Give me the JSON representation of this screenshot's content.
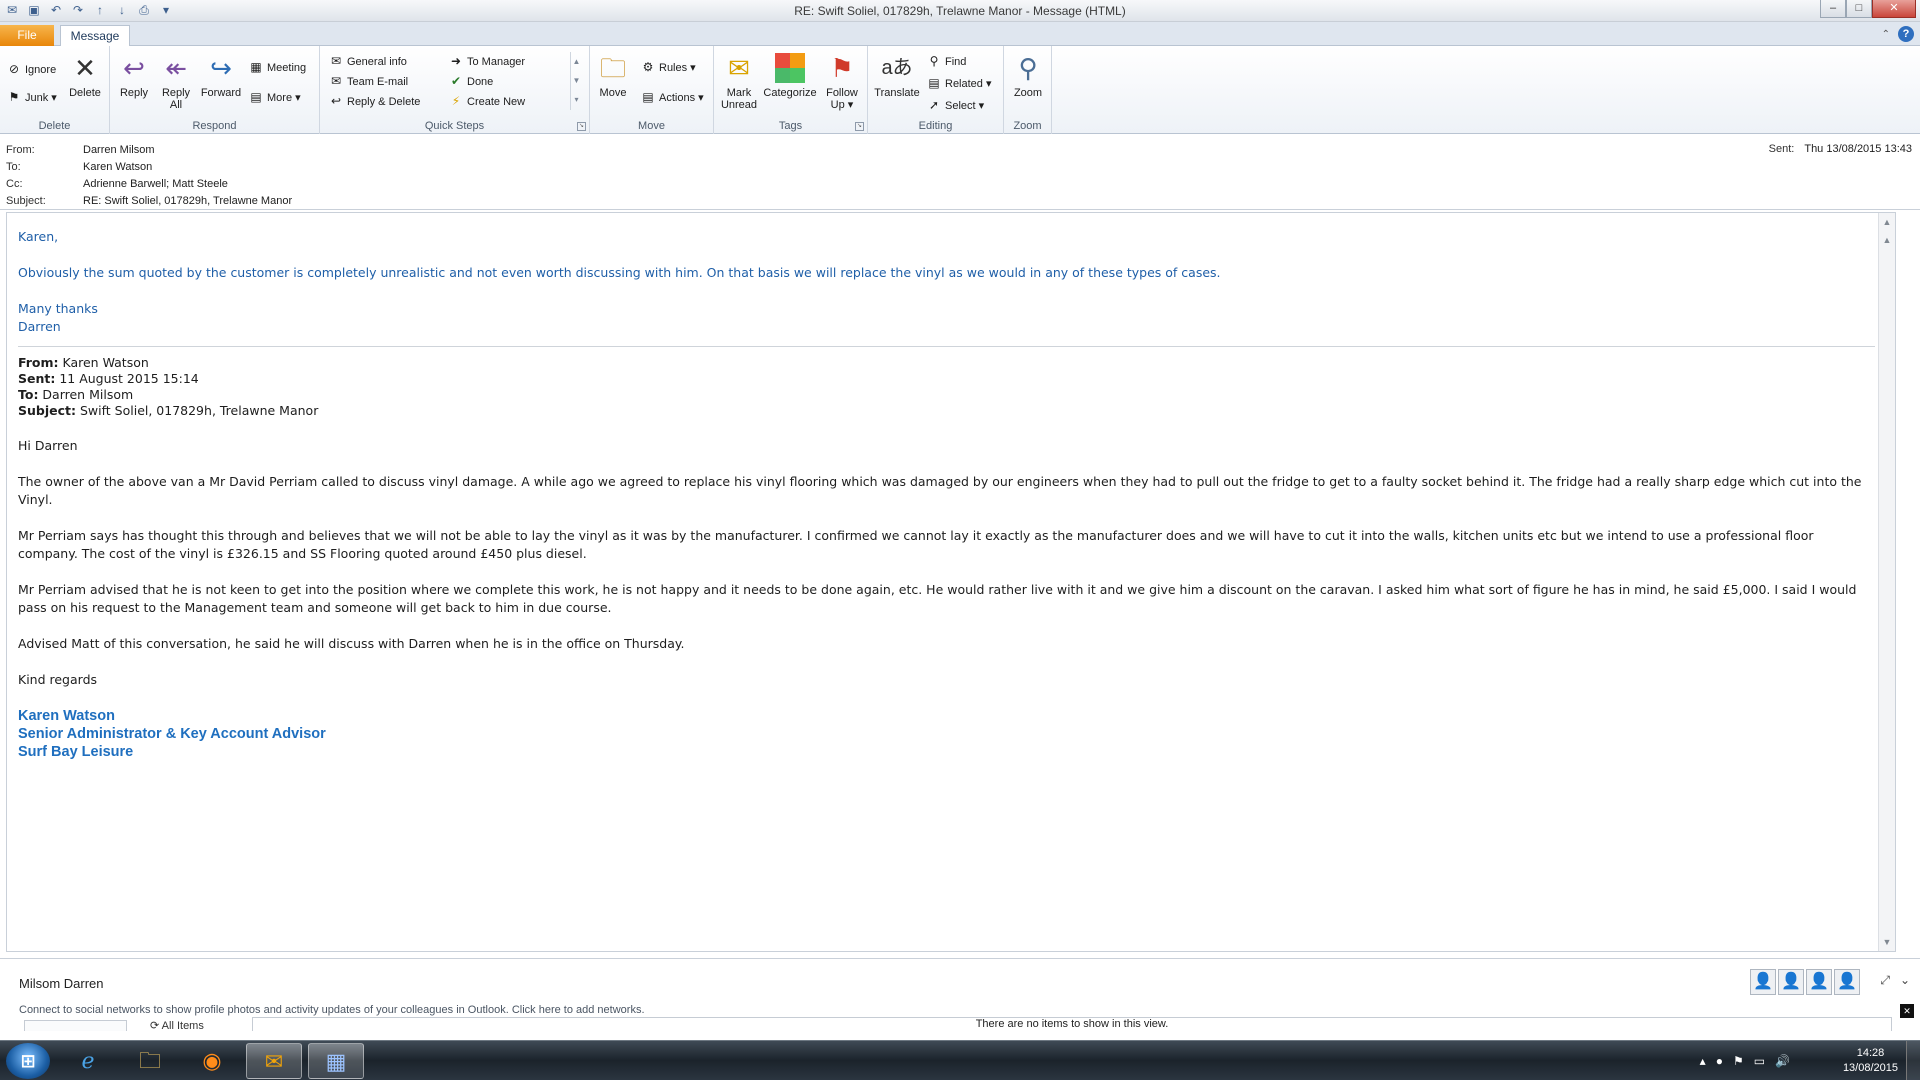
{
  "window": {
    "title": "RE: Swift Soliel,  017829h, Trelawne Manor  -  Message (HTML)",
    "minimize": "–",
    "maximize": "□",
    "close": "✕"
  },
  "tabs": {
    "file": "File",
    "message": "Message"
  },
  "ribbon": {
    "delete_group": {
      "label": "Delete",
      "ignore": "Ignore",
      "junk": "Junk ▾",
      "delete": "Delete"
    },
    "respond_group": {
      "label": "Respond",
      "reply": "Reply",
      "reply_all_line1": "Reply",
      "reply_all_line2": "All",
      "forward": "Forward",
      "meeting": "Meeting",
      "more": "More ▾"
    },
    "quicksteps_group": {
      "label": "Quick Steps",
      "items": [
        "General info",
        "Team E-mail",
        "Reply & Delete",
        "To Manager",
        "Done",
        "Create New"
      ]
    },
    "move_group": {
      "label": "Move",
      "move": "Move",
      "rules": "Rules ▾",
      "actions": "Actions ▾"
    },
    "tags_group": {
      "label": "Tags",
      "mark_unread_line1": "Mark",
      "mark_unread_line2": "Unread",
      "categorize": "Categorize",
      "follow_up_line1": "Follow",
      "follow_up_line2": "Up ▾"
    },
    "editing_group": {
      "label": "Editing",
      "translate": "Translate",
      "find": "Find",
      "related": "Related ▾",
      "select": "Select ▾"
    },
    "zoom_group": {
      "label": "Zoom",
      "zoom": "Zoom"
    }
  },
  "header": {
    "from_label": "From:",
    "from": "Darren Milsom",
    "to_label": "To:",
    "to": "Karen Watson",
    "cc_label": "Cc:",
    "cc": "Adrienne Barwell; Matt Steele",
    "subject_label": "Subject:",
    "subject": "RE: Swift Soliel,  017829h, Trelawne Manor",
    "sent_label": "Sent:",
    "sent": "Thu 13/08/2015 13:43"
  },
  "body": {
    "reply": {
      "greeting": "Karen,",
      "paragraph": "Obviously the sum quoted by the customer is completely unrealistic and not even worth discussing with him. On that basis we will replace the vinyl as we would in any of these types of cases.",
      "closing": "Many thanks",
      "name": "Darren"
    },
    "original": {
      "from_label": "From:",
      "from": " Karen Watson",
      "sent_label": "Sent:",
      "sent": " 11 August 2015 15:14",
      "to_label": "To:",
      "to": " Darren Milsom",
      "subject_label": "Subject:",
      "subject": " Swift Soliel, 017829h, Trelawne Manor",
      "greeting": "Hi Darren",
      "paragraphs": [
        "The owner of the above van a Mr David Perriam called to discuss vinyl damage. A while ago we agreed to replace his vinyl flooring which was damaged by our engineers when they had to pull out the fridge to get to a faulty socket behind it. The fridge had a really sharp edge which cut into the Vinyl.",
        "Mr Perriam says has thought this through and believes that we will not be able to lay the vinyl as it was by the manufacturer. I confirmed we cannot lay it exactly as the manufacturer does and we will have to cut it into the walls, kitchen units etc but we intend to use a professional floor company.  The cost of the vinyl is £326.15 and SS Flooring quoted around £450 plus diesel.",
        "Mr Perriam advised that he is not keen to get into the position where we complete this work, he is not happy and it needs to be done again, etc. He would rather live with it and we give him a discount on the caravan. I asked him what sort of figure he has in mind, he said £5,000. I said I would pass on his request to the Management team and someone will get back to him in due course.",
        "Advised Matt of this conversation, he said he will discuss with Darren when he is in the office on Thursday."
      ],
      "closing": "Kind regards",
      "signature": [
        "Karen Watson",
        "Senior Administrator & Key Account Advisor",
        "Surf Bay Leisure"
      ]
    }
  },
  "people_pane": {
    "name": "Milsom Darren",
    "message": "Connect to social networks to show profile photos and activity updates of your colleagues in Outlook. Click here to add networks.",
    "all_items": "All Items",
    "no_items": "There are no items to show in this view."
  },
  "taskbar": {
    "time": "14:28",
    "date": "13/08/2015"
  },
  "colors": {
    "accent_blue": "#1f5fa8",
    "signature_blue": "#1f6fbf",
    "file_tab": "#e8860a"
  }
}
